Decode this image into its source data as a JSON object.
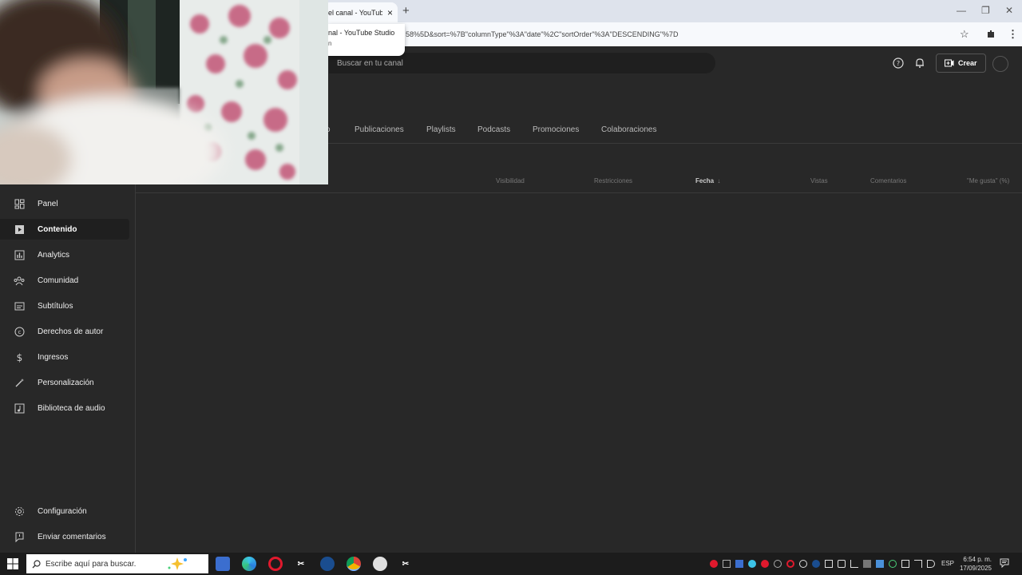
{
  "browser": {
    "tab_title": "el canal - YouTube Studio",
    "tab_close": "×",
    "new_tab": "+",
    "url": "58%5D&sort=%7B\"columnType\"%3A\"date\"%2C\"sortOrder\"%3A\"DESCENDING\"%7D",
    "tooltip_title": "nal - YouTube Studio",
    "tooltip_sub": "n",
    "win_min": "—",
    "win_max": "❐",
    "win_close": "✕"
  },
  "header": {
    "search_placeholder": "Buscar en tu canal",
    "create_label": "Crear"
  },
  "tabs": [
    {
      "label": "o"
    },
    {
      "label": "Publicaciones"
    },
    {
      "label": "Playlists"
    },
    {
      "label": "Podcasts"
    },
    {
      "label": "Promociones"
    },
    {
      "label": "Colaboraciones"
    }
  ],
  "table": {
    "columns": [
      {
        "label": "Visibilidad"
      },
      {
        "label": "Restricciones"
      },
      {
        "label": "Fecha"
      },
      {
        "label": "Vistas"
      },
      {
        "label": "Comentarios"
      },
      {
        "label": "\"Me gusta\" (%)"
      }
    ],
    "sort_arrow": "↓"
  },
  "sidebar": {
    "items": [
      {
        "label": "Panel",
        "icon": "dashboard-icon"
      },
      {
        "label": "Contenido",
        "icon": "content-icon",
        "active": true
      },
      {
        "label": "Analytics",
        "icon": "analytics-icon"
      },
      {
        "label": "Comunidad",
        "icon": "community-icon"
      },
      {
        "label": "Subtítulos",
        "icon": "subtitles-icon"
      },
      {
        "label": "Derechos de autor",
        "icon": "copyright-icon"
      },
      {
        "label": "Ingresos",
        "icon": "dollar-icon"
      },
      {
        "label": "Personalización",
        "icon": "magic-wand-icon"
      },
      {
        "label": "Biblioteca de audio",
        "icon": "audio-library-icon"
      }
    ],
    "bottom": [
      {
        "label": "Configuración",
        "icon": "gear-icon"
      },
      {
        "label": "Enviar comentarios",
        "icon": "feedback-icon"
      }
    ]
  },
  "taskbar": {
    "search_placeholder": "Escribe aquí para buscar.",
    "lang": "ESP",
    "time": "6:54 p. m.",
    "date": "17/09/2025"
  }
}
